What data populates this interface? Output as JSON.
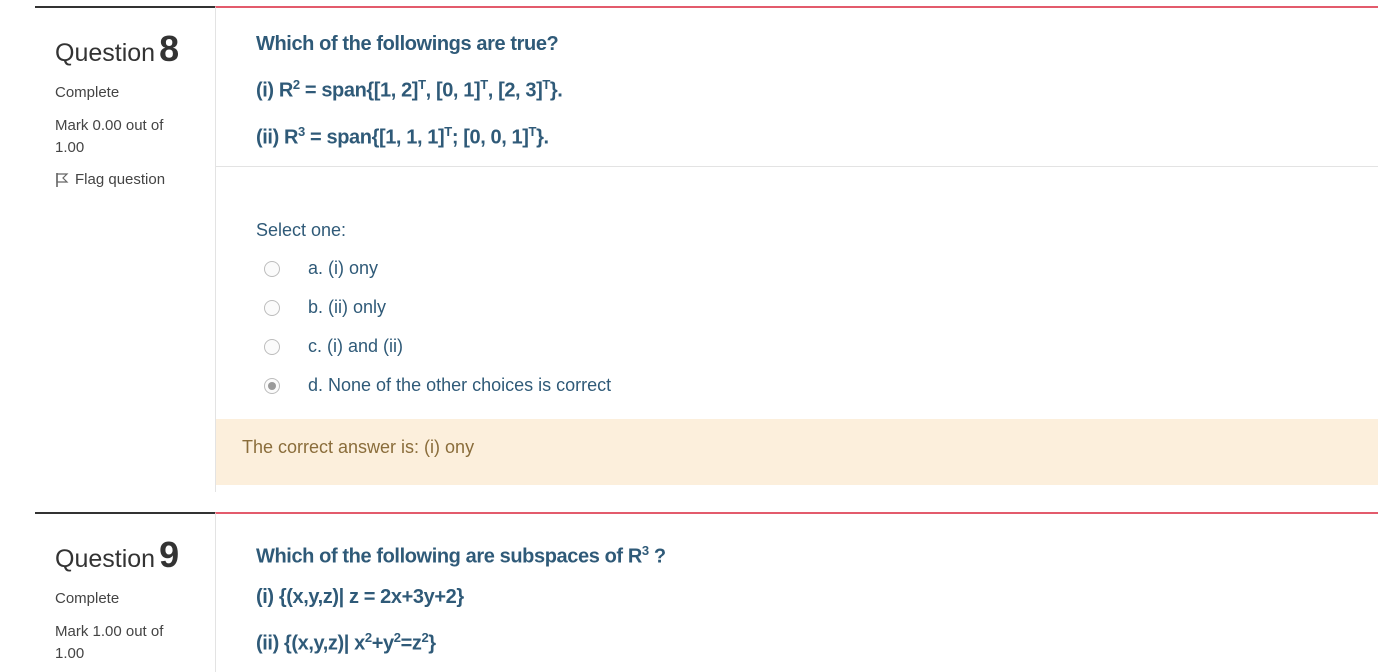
{
  "questions": [
    {
      "label": "Question",
      "number": "8",
      "state": "Complete",
      "grade": "Mark 0.00 out of 1.00",
      "flag": "Flag question",
      "text": "Which of the followings are true?",
      "statement_1_prefix": "(i) R",
      "statement_1_exp": "2",
      "statement_1_rest": " = span{[1, 2]",
      "statement_1_parts": [
        "T",
        ", [0, 1]",
        "T",
        ", [2, 3]",
        "T",
        "}."
      ],
      "statement_2_prefix": "(ii) R",
      "statement_2_exp": "3",
      "statement_2_rest": " = span{[1, 1, 1]",
      "statement_2_parts": [
        "T",
        "; [0, 0, 1]",
        "T",
        "}."
      ],
      "prompt": "Select one:",
      "answers": [
        {
          "label": "a. (i) ony",
          "checked": false
        },
        {
          "label": "b. (ii) only",
          "checked": false
        },
        {
          "label": "c. (i) and (ii)",
          "checked": false
        },
        {
          "label": "d. None of the other choices is correct",
          "checked": true
        }
      ],
      "feedback": "The correct answer is: (i) ony"
    },
    {
      "label": "Question",
      "number": "9",
      "state": "Complete",
      "grade": "Mark 1.00 out of 1.00",
      "text_prefix": "Which of the following are subspaces of R",
      "text_exp": "3",
      "text_suffix": " ?",
      "statement_1": "(i) {(x,y,z)| z = 2x+3y+2}",
      "statement_2_a": "(ii) {(x,y,z)| x",
      "statement_2_b": "2",
      "statement_2_c": "+y",
      "statement_2_d": "2",
      "statement_2_e": "=z",
      "statement_2_f": "2",
      "statement_2_g": "}"
    }
  ]
}
